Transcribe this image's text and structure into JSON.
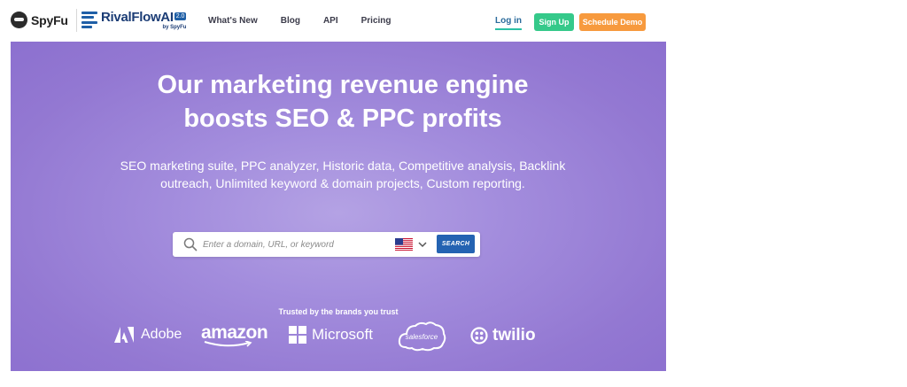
{
  "header": {
    "spyfu_logo": "SpyFu",
    "rivalflow_logo": "RivalFlowAI",
    "rivalflow_version": "2.0",
    "rivalflow_byline": "by SpyFu",
    "nav": [
      "What's New",
      "Blog",
      "API",
      "Pricing"
    ],
    "login": "Log in",
    "signup": "Sign Up",
    "demo": "Schedule Demo"
  },
  "hero": {
    "headline_line1": "Our marketing revenue engine",
    "headline_line2": "boosts SEO & PPC profits",
    "subtext": "SEO marketing suite, PPC analyzer, Historic data, Competitive analysis, Backlink outreach, Unlimited keyword & domain projects, Custom reporting.",
    "search": {
      "placeholder": "Enter a domain, URL, or keyword",
      "value": "",
      "country_icon": "us-flag-icon",
      "button": "SEARCH"
    },
    "trusted_label": "Trusted by the brands you trust",
    "brands": [
      "Adobe",
      "amazon",
      "Microsoft",
      "salesforce",
      "twilio"
    ]
  },
  "colors": {
    "hero_bg": "#9378d2",
    "signup_bg": "#35c98a",
    "demo_bg": "#f79a3e",
    "search_button_bg": "#2463b2",
    "login_underline": "#2bc0a4"
  }
}
